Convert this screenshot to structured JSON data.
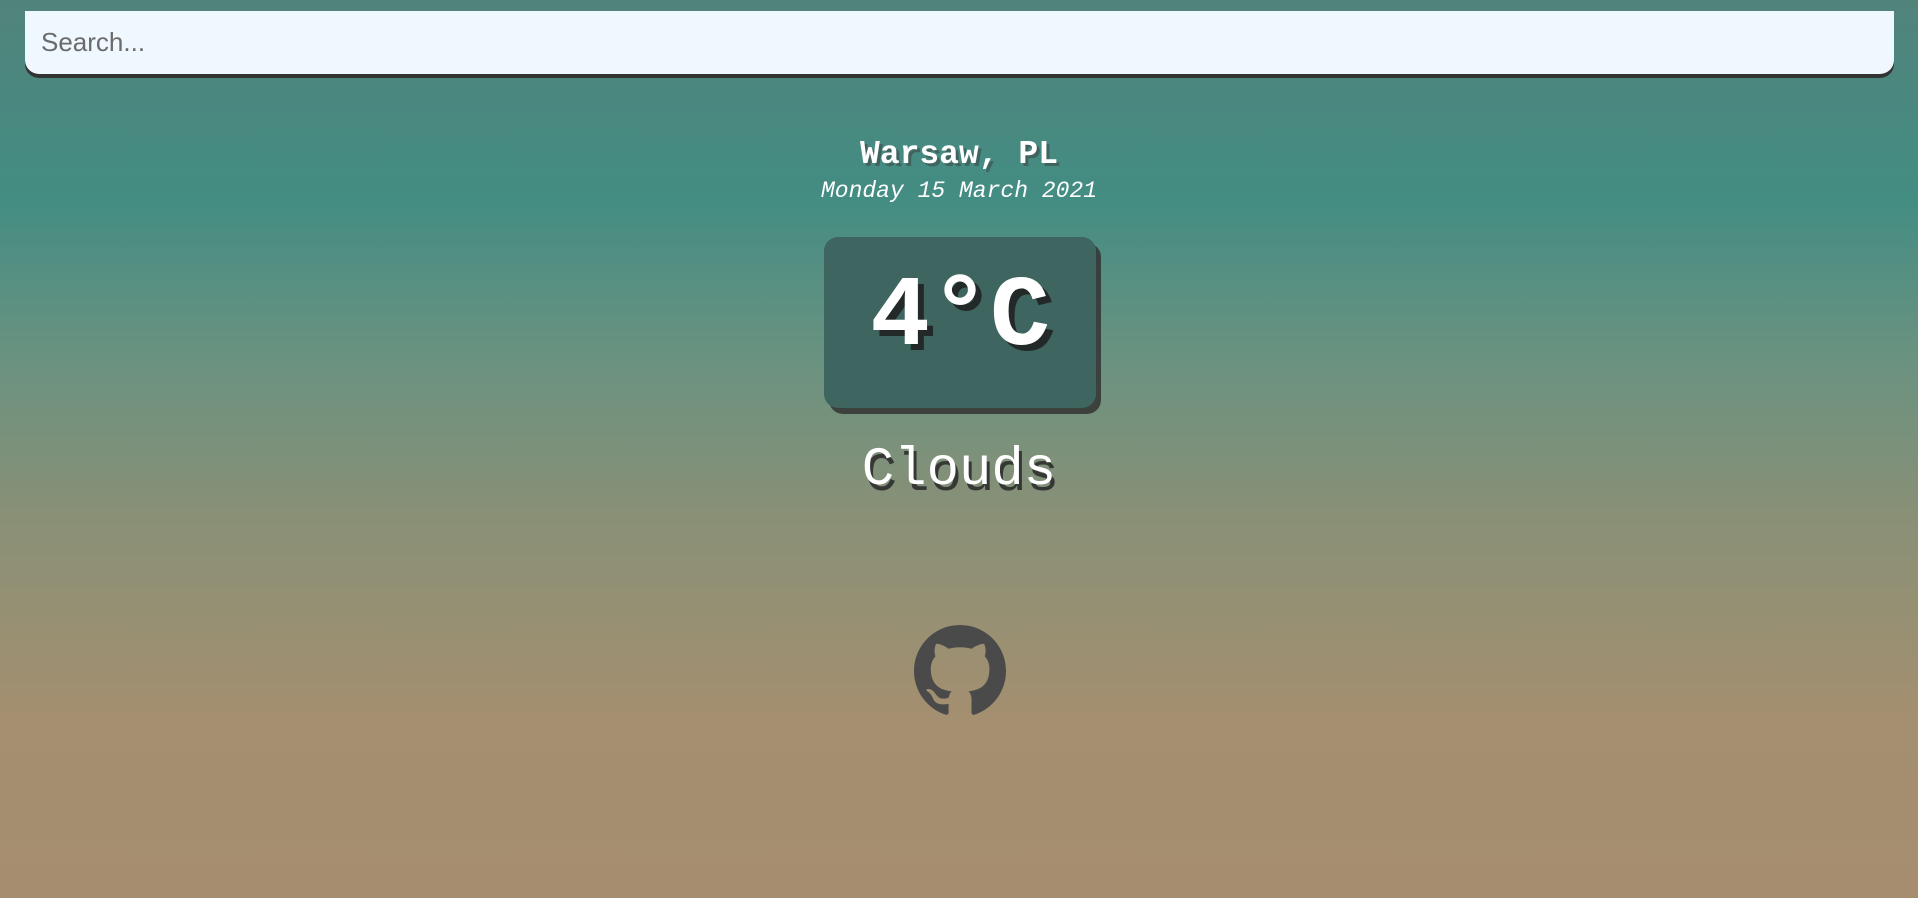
{
  "search": {
    "placeholder": "Search...",
    "value": ""
  },
  "weather": {
    "location": "Warsaw, PL",
    "date": "Monday 15 March 2021",
    "temperature": "4°C",
    "condition": "Clouds"
  },
  "footer": {
    "icon": "github-icon"
  },
  "colors": {
    "search_bg": "#eff7ff",
    "temp_box_bg": "#3e6560",
    "text": "#ffffff",
    "icon": "#4a4a4a"
  }
}
